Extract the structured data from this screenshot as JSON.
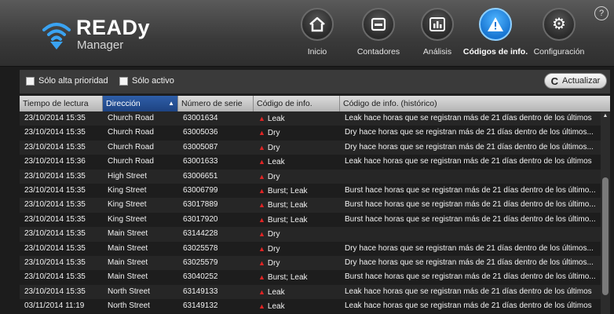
{
  "app": {
    "title": "READy",
    "subtitle": "Manager",
    "help": "?"
  },
  "nav": [
    {
      "label": "Inicio",
      "icon": "home-icon",
      "active": false
    },
    {
      "label": "Contadores",
      "icon": "meter-icon",
      "active": false
    },
    {
      "label": "Análisis",
      "icon": "chart-icon",
      "active": false
    },
    {
      "label": "Códigos de info.",
      "icon": "warning-icon",
      "active": true
    },
    {
      "label": "Configuración",
      "icon": "gear-icon",
      "active": false
    }
  ],
  "toolbar": {
    "filter_priority": "Sólo alta prioridad",
    "filter_active": "Sólo activo",
    "refresh_label": "Actualizar",
    "refresh_icon": "refresh-icon"
  },
  "table": {
    "columns": [
      "Tiempo de lectura",
      "Dirección",
      "Número de serie",
      "Código de info.",
      "Código de info. (histórico)"
    ],
    "sorted_column": "Dirección",
    "rows": [
      [
        "23/10/2014 15:35",
        "Church Road",
        "63001634",
        "Leak",
        "Leak hace horas que se registran más de 21 días dentro de los últimos"
      ],
      [
        "23/10/2014 15:35",
        "Church Road",
        "63005036",
        "Dry",
        "Dry hace horas que se registran más de 21 días dentro de los últimos..."
      ],
      [
        "23/10/2014 15:35",
        "Church Road",
        "63005087",
        "Dry",
        "Dry hace horas que se registran más de 21 días dentro de los últimos..."
      ],
      [
        "23/10/2014 15:36",
        "Church Road",
        "63001633",
        "Leak",
        "Leak hace horas que se registran más de 21 días dentro de los últimos"
      ],
      [
        "23/10/2014 15:35",
        "High Street",
        "63006651",
        "Dry",
        ""
      ],
      [
        "23/10/2014 15:35",
        "King Street",
        "63006799",
        "Burst; Leak",
        "Burst hace horas que se registran más de 21 días dentro de los último..."
      ],
      [
        "23/10/2014 15:35",
        "King Street",
        "63017889",
        "Burst; Leak",
        "Burst hace horas que se registran más de 21 días dentro de los último..."
      ],
      [
        "23/10/2014 15:35",
        "King Street",
        "63017920",
        "Burst; Leak",
        "Burst hace horas que se registran más de 21 días dentro de los último..."
      ],
      [
        "23/10/2014 15:35",
        "Main Street",
        "63144228",
        "Dry",
        ""
      ],
      [
        "23/10/2014 15:35",
        "Main Street",
        "63025578",
        "Dry",
        "Dry hace horas que se registran más de 21 días dentro de los últimos..."
      ],
      [
        "23/10/2014 15:35",
        "Main Street",
        "63025579",
        "Dry",
        "Dry hace horas que se registran más de 21 días dentro de los últimos..."
      ],
      [
        "23/10/2014 15:35",
        "Main Street",
        "63040252",
        "Burst; Leak",
        "Burst hace horas que se registran más de 21 días dentro de los último..."
      ],
      [
        "23/10/2014 15:35",
        "North Street",
        "63149133",
        "Leak",
        "Leak hace horas que se registran más de 21 días dentro de los últimos"
      ],
      [
        "03/11/2014 11:19",
        "North Street",
        "63149132",
        "Leak",
        "Leak hace horas que se registran más de 21 días dentro de los últimos"
      ]
    ]
  },
  "colors": {
    "accent": "#1876d2",
    "warning": "#e02424",
    "header_sorted": "#2e5ea8"
  }
}
